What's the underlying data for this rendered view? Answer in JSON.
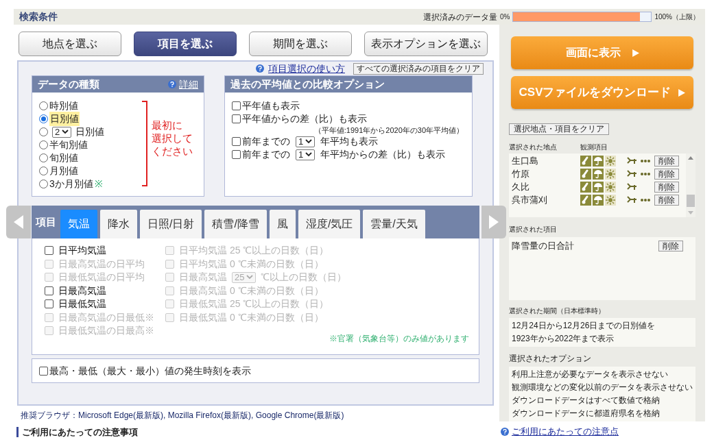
{
  "header": {
    "title": "検索条件",
    "quota": {
      "label": "選択済みのデータ量",
      "min": "0%",
      "level": 0.92,
      "max": "100%（上限）"
    }
  },
  "nav_buttons": [
    {
      "label": "地点を選ぶ",
      "selected": false
    },
    {
      "label": "項目を選ぶ",
      "selected": true
    },
    {
      "label": "期間を選ぶ",
      "selected": false
    },
    {
      "label": "表示オプションを選ぶ",
      "selected": false
    }
  ],
  "help_link": "項目選択の使い方",
  "clear_all_button": "すべての選択済みの項目をクリア",
  "data_type": {
    "title": "データの種類",
    "detail_link": "詳細",
    "options": [
      {
        "kind": "radio",
        "label": "時別値",
        "selected": false
      },
      {
        "kind": "radio",
        "label": "日別値",
        "selected": true
      },
      {
        "kind": "select",
        "value": "2",
        "suffix": "日別値",
        "selected": false
      },
      {
        "kind": "radio",
        "label": "半旬別値",
        "selected": false
      },
      {
        "kind": "radio",
        "label": "旬別値",
        "selected": false
      },
      {
        "kind": "radio",
        "label": "月別値",
        "selected": false
      },
      {
        "kind": "radio",
        "label": "3か月別値",
        "note": "※",
        "selected": false
      }
    ],
    "hint_lines": [
      "最初に",
      "選択して",
      "ください"
    ]
  },
  "comparison": {
    "title": "過去の平均値との比較オプション",
    "options": [
      {
        "kind": "check",
        "label": "平年値も表示",
        "checked": false
      },
      {
        "kind": "check",
        "label": "平年値からの差（比）も表示",
        "checked": false,
        "note": "（平年値:1991年から2020年の30年平均値）"
      },
      {
        "kind": "select",
        "prefix": "前年までの",
        "value": "1",
        "label": "年平均も表示",
        "checked": false
      },
      {
        "kind": "select",
        "prefix": "前年までの",
        "value": "1",
        "label": "年平均からの差（比）も表示",
        "checked": false
      }
    ]
  },
  "items": {
    "label": "項目",
    "tabs": [
      {
        "label": "気温",
        "selected": true
      },
      {
        "label": "降水",
        "selected": false
      },
      {
        "label": "日照/日射",
        "selected": false
      },
      {
        "label": "積雪/降雪",
        "selected": false
      },
      {
        "label": "風",
        "selected": false
      },
      {
        "label": "湿度/気圧",
        "selected": false
      },
      {
        "label": "雲量/天気",
        "selected": false
      }
    ],
    "left": [
      {
        "label": "日平均気温",
        "disabled": false,
        "checked": false
      },
      {
        "label": "日最高気温の日平均",
        "disabled": true,
        "checked": false
      },
      {
        "label": "日最低気温の日平均",
        "disabled": true,
        "checked": false
      },
      {
        "label": "日最高気温",
        "disabled": false,
        "checked": false
      },
      {
        "label": "日最低気温",
        "disabled": false,
        "checked": false
      },
      {
        "label": "日最高気温の日最低※",
        "disabled": true,
        "checked": false
      },
      {
        "label": "日最低気温の日最高※",
        "disabled": true,
        "checked": false
      }
    ],
    "right": [
      {
        "kind": "check",
        "label": "日平均気温 25 ℃以上の日数（日）",
        "disabled": true,
        "checked": false
      },
      {
        "kind": "check",
        "label": "日平均気温 0 ℃未満の日数（日）",
        "disabled": true,
        "checked": false
      },
      {
        "kind": "select",
        "label": "日最高気温",
        "value": "25",
        "suffix": "℃以上の日数（日）",
        "disabled": true,
        "checked": false
      },
      {
        "kind": "check",
        "label": "日最高気温 0 ℃未満の日数（日）",
        "disabled": true,
        "checked": false
      },
      {
        "kind": "check",
        "label": "日最低気温 25 ℃以上の日数（日）",
        "disabled": true,
        "checked": false
      },
      {
        "kind": "check",
        "label": "日最低気温 0 ℃未満の日数（日）",
        "disabled": true,
        "checked": false
      }
    ],
    "note": "※官署（気象台等）のみ値があります"
  },
  "time_option": {
    "label": "最高・最低（最大・最小）値の発生時刻を表示",
    "checked": false
  },
  "browser_note": "推奨ブラウザ：Microsoft Edge(最新版), Mozilla Firefox(最新版), Google Chrome(最新版)",
  "notes_heading": "ご利用にあたっての注意事項",
  "sidebar": {
    "show_button": "画面に表示",
    "csv_button": "CSVファイルをダウンロード",
    "clear_button": "選択地点・項目をクリア",
    "stations_label": "選択された地点",
    "elements_label": "観測項目",
    "stations": [
      {
        "name": "生口島",
        "more": true,
        "delete": "削除"
      },
      {
        "name": "竹原",
        "more": true,
        "delete": "削除"
      },
      {
        "name": "久比",
        "more": false,
        "delete": "削除"
      },
      {
        "name": "呉市蒲刈",
        "more": true,
        "delete": "削除"
      }
    ],
    "items_label": "選択された項目",
    "selected_items": [
      {
        "name": "降雪量の日合計",
        "delete": "削除"
      }
    ],
    "period_label": "選択された期間（日本標準時）",
    "period_lines": [
      "12月24日から12月26日までの日別値を",
      "1923年から2022年まで表示"
    ],
    "options_label": "選択されたオプション",
    "option_lines": [
      "利用上注意が必要なデータを表示させない",
      "観測環境などの変化以前のデータを表示させない",
      "ダウンロードデータはすべて数値で格納",
      "ダウンロードデータに都道府県名を格納"
    ]
  },
  "notes_link": "ご利用にあたっての注意点"
}
